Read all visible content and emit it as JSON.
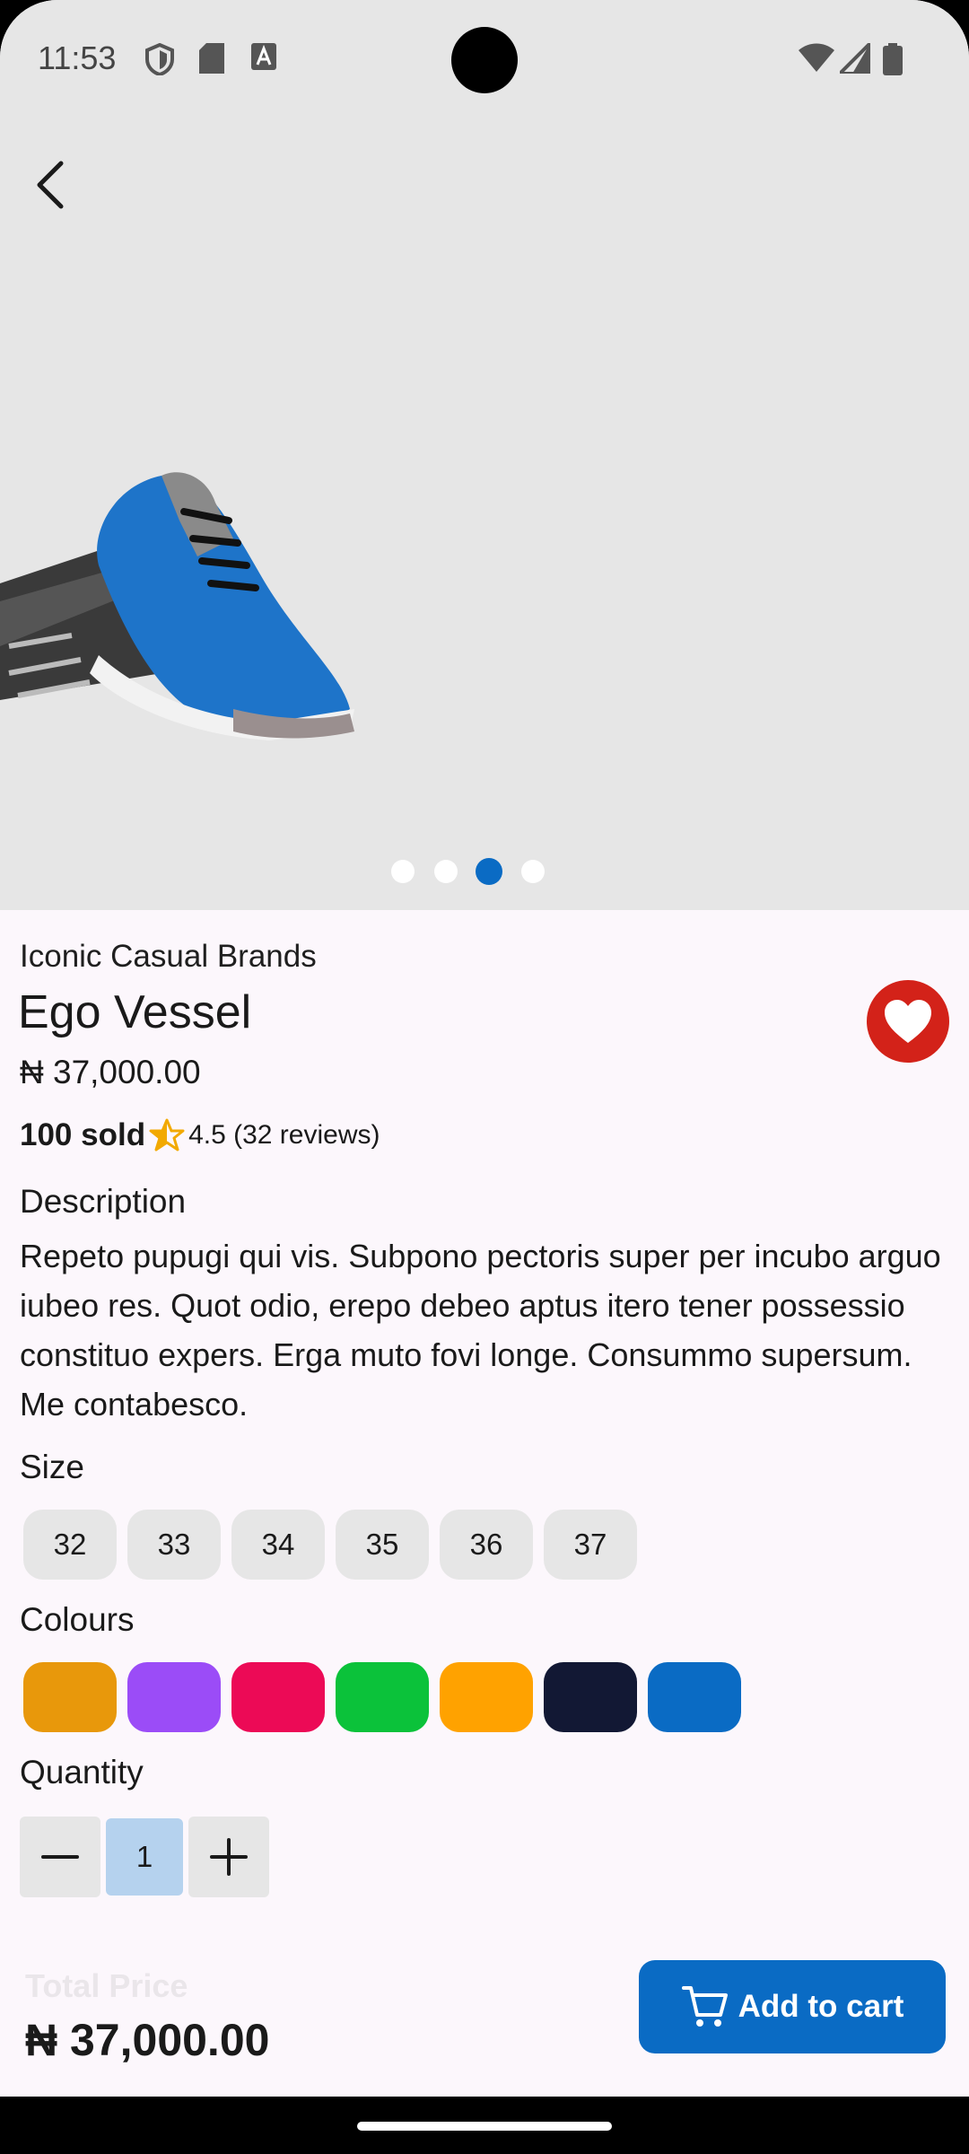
{
  "status": {
    "time": "11:53"
  },
  "colors": {
    "accent": "#0A6BC4",
    "favorite": "#D32219",
    "background": "#FCF7FC",
    "hero_background": "#E6E6E6",
    "chip": "#E6E6E6",
    "quantity_value_bg": "#B5D2EE"
  },
  "gallery": {
    "page_count": 4,
    "active_index": 2
  },
  "product": {
    "brand": "Iconic Casual Brands",
    "name": "Ego Vessel",
    "price": "₦ 37,000.00",
    "sold": "100 sold",
    "rating": "4.5 (32 reviews)",
    "favorited": true
  },
  "description": {
    "label": "Description",
    "text": "Repeto pupugi qui vis. Subpono pectoris super per incubo arguo iubeo res. Quot odio, erepo debeo aptus itero tener possessio constituo expers. Erga muto fovi longe. Consummo supersum. Me contabesco."
  },
  "size": {
    "label": "Size",
    "options": [
      "32",
      "33",
      "34",
      "35",
      "36",
      "37"
    ]
  },
  "colours": {
    "label": "Colours",
    "options": [
      "#E8980B",
      "#9B4CF7",
      "#EC0A56",
      "#0BC23A",
      "#FFA200",
      "#121834",
      "#0A6BC4"
    ]
  },
  "quantity": {
    "label": "Quantity",
    "value": "1"
  },
  "footer": {
    "total_label": "Total Price",
    "total_value": "₦ 37,000.00",
    "cart_label": "Add to cart"
  }
}
